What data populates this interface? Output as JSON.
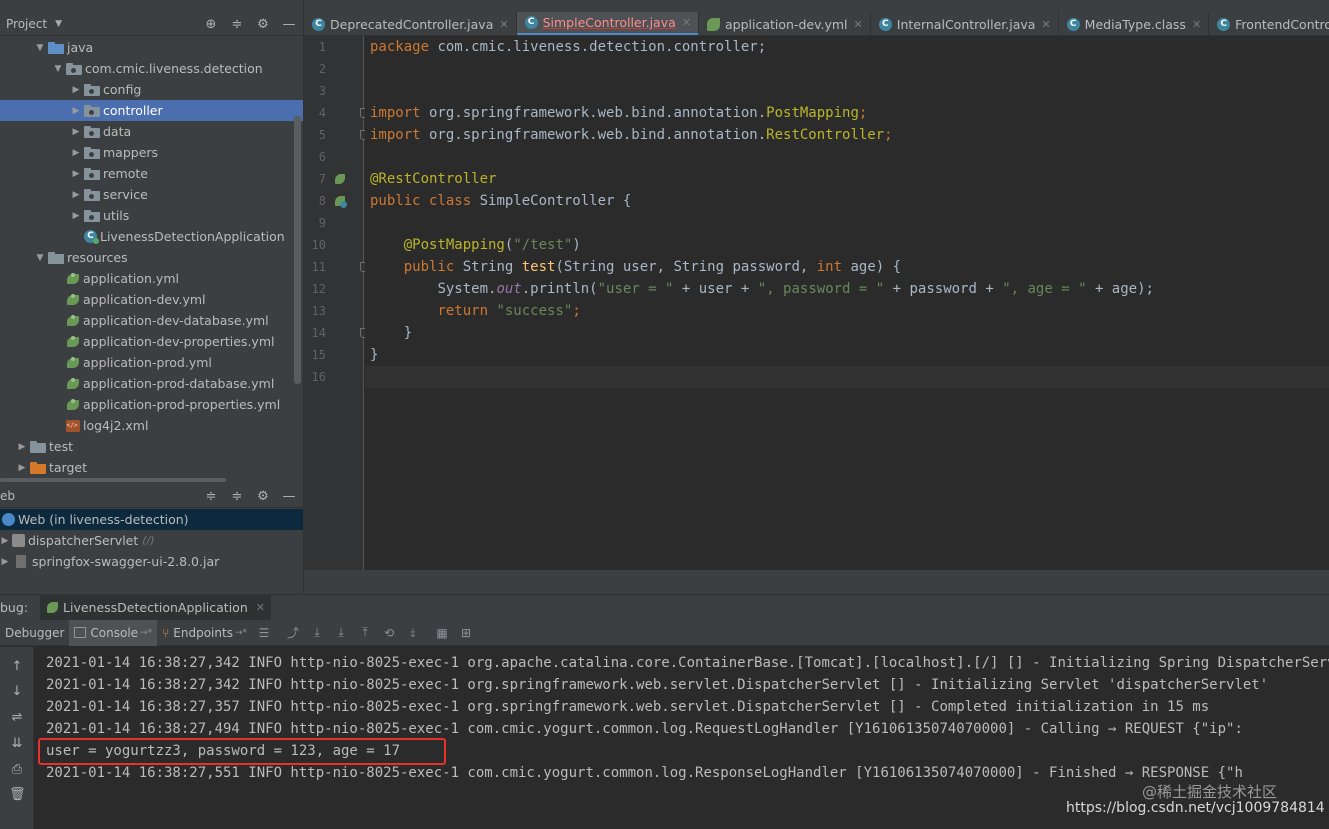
{
  "project_panel": {
    "title": "Project",
    "tree": [
      {
        "label": "java",
        "icon": "folder-blue",
        "expanded": true
      },
      {
        "label": "com.cmic.liveness.detection",
        "icon": "package",
        "expanded": true
      },
      {
        "label": "config",
        "icon": "package"
      },
      {
        "label": "controller",
        "icon": "package",
        "selected": true
      },
      {
        "label": "data",
        "icon": "package"
      },
      {
        "label": "mappers",
        "icon": "package"
      },
      {
        "label": "remote",
        "icon": "package"
      },
      {
        "label": "service",
        "icon": "package"
      },
      {
        "label": "utils",
        "icon": "package"
      },
      {
        "label": "LivenessDetectionApplication",
        "icon": "class"
      },
      {
        "label": "resources",
        "icon": "folder",
        "expanded": true
      },
      {
        "label": "application.yml",
        "icon": "yml"
      },
      {
        "label": "application-dev.yml",
        "icon": "yml"
      },
      {
        "label": "application-dev-database.yml",
        "icon": "yml"
      },
      {
        "label": "application-dev-properties.yml",
        "icon": "yml"
      },
      {
        "label": "application-prod.yml",
        "icon": "yml"
      },
      {
        "label": "application-prod-database.yml",
        "icon": "yml"
      },
      {
        "label": "application-prod-properties.yml",
        "icon": "yml"
      },
      {
        "label": "log4j2.xml",
        "icon": "xml"
      },
      {
        "label": "test",
        "icon": "folder"
      },
      {
        "label": "target",
        "icon": "folder-orange"
      }
    ]
  },
  "web_panel": {
    "title": "eb",
    "items": [
      {
        "label": "Web (in liveness-detection)",
        "selected": true
      },
      {
        "label": "dispatcherServlet",
        "suffix": "(/)"
      },
      {
        "label": "springfox-swagger-ui-2.8.0.jar"
      }
    ]
  },
  "editor": {
    "tabs": [
      {
        "label": "DeprecatedController.java",
        "icon": "class"
      },
      {
        "label": "SimpleController.java",
        "icon": "class",
        "active": true
      },
      {
        "label": "application-dev.yml",
        "icon": "yml"
      },
      {
        "label": "InternalController.java",
        "icon": "class"
      },
      {
        "label": "MediaType.class",
        "icon": "class"
      },
      {
        "label": "FrontendController.java",
        "icon": "class"
      }
    ],
    "line_numbers": [
      "1",
      "2",
      "3",
      "4",
      "5",
      "6",
      "7",
      "8",
      "9",
      "10",
      "11",
      "12",
      "13",
      "14",
      "15",
      "16"
    ],
    "code": {
      "l1_kw": "package",
      "l1_rest": " com.cmic.liveness.detection.controller;",
      "l4_kw": "import",
      "l4_pkg": " org.springframework.web.bind.annotation.",
      "l4_cls": "PostMapping",
      "l4_end": ";",
      "l5_kw": "import",
      "l5_pkg": " org.springframework.web.bind.annotation.",
      "l5_cls": "RestController",
      "l5_end": ";",
      "l7_ann": "@RestController",
      "l8_kw": "public class",
      "l8_rest": " SimpleController {",
      "l10_ann": "@PostMapping",
      "l10_open": "(",
      "l10_str": "\"/test\"",
      "l10_close": ")",
      "l11_kw": "public",
      "l11_type": " String ",
      "l11_fn": "test",
      "l11_args1": "(String user, String password, ",
      "l11_kw2": "int",
      "l11_args2": " age) {",
      "l12_a": "System.",
      "l12_out": "out",
      "l12_b": ".println(",
      "l12_s1": "\"user = \"",
      "l12_c": " + user + ",
      "l12_s2": "\", password = \"",
      "l12_d": " + password + ",
      "l12_s3": "\", age = \"",
      "l12_e": " + age);",
      "l13_kw": "return",
      "l13_str": " \"success\"",
      "l13_end": ";",
      "l14": "}",
      "l15": "}"
    }
  },
  "debug": {
    "label": "bug:",
    "session_tab": "LivenessDetectionApplication",
    "toolbar": {
      "debugger": "Debugger",
      "console": "Console",
      "endpoints": "Endpoints"
    },
    "console_lines": [
      "2021-01-14 16:38:27,342 INFO http-nio-8025-exec-1 org.apache.catalina.core.ContainerBase.[Tomcat].[localhost].[/] [] - Initializing Spring DispatcherServlet 'dispatcherServlet'",
      "2021-01-14 16:38:27,342 INFO http-nio-8025-exec-1 org.springframework.web.servlet.DispatcherServlet [] - Initializing Servlet 'dispatcherServlet'",
      "2021-01-14 16:38:27,357 INFO http-nio-8025-exec-1 org.springframework.web.servlet.DispatcherServlet [] - Completed initialization in 15 ms",
      "2021-01-14 16:38:27,494 INFO http-nio-8025-exec-1 com.cmic.yogurt.common.log.RequestLogHandler [Y16106135074070000] - Calling → REQUEST {\"ip\":",
      "user = yogurtzz3, password = 123, age = 17",
      "2021-01-14 16:38:27,551 INFO http-nio-8025-exec-1 com.cmic.yogurt.common.log.ResponseLogHandler [Y16106135074070000] - Finished → RESPONSE {\"h"
    ]
  },
  "watermark": {
    "cn": "@稀土掘金技术社区",
    "url": "https://blog.csdn.net/vcj1009784814"
  }
}
